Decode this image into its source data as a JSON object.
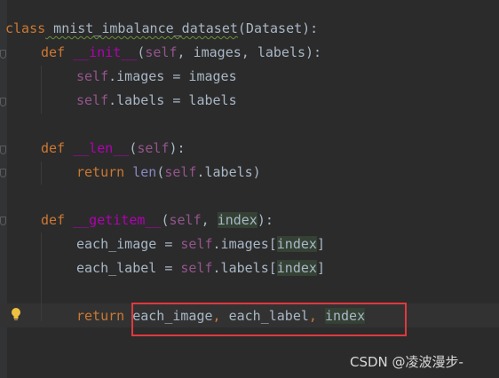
{
  "code": {
    "line1": {
      "kw": "class",
      "name": " mnist_imbalance_dataset",
      "rest": "(Dataset):"
    },
    "line2": {
      "kw": "def",
      "name": "__init__",
      "open": "(",
      "self": "self",
      "rest": ", images, labels):"
    },
    "line3": {
      "self": "self",
      "rest": ".images = images"
    },
    "line4": {
      "self": "self",
      "rest": ".labels = labels"
    },
    "line6": {
      "kw": "def",
      "name": "__len__",
      "open": "(",
      "self": "self",
      "rest": "):"
    },
    "line7": {
      "kw": "return",
      "builtin": "len",
      "open": "(",
      "self": "self",
      "rest": ".labels)"
    },
    "line9": {
      "kw": "def",
      "name": "__getitem__",
      "open": "(",
      "self": "self",
      "comma": ", ",
      "param": "index",
      "rest": "):"
    },
    "line10": {
      "lhs": "each_image = ",
      "self": "self",
      "attr": ".images[",
      "param": "index",
      "close": "]"
    },
    "line11": {
      "lhs": "each_label = ",
      "self": "self",
      "attr": ".labels[",
      "param": "index",
      "close": "]"
    },
    "line13": {
      "kw": "return",
      "v1": " each_image",
      "c1": ", ",
      "v2": "each_label",
      "c2": ", ",
      "param": "index"
    }
  },
  "watermark": "CSDN @凌波漫步-",
  "colors": {
    "background": "#2b2b2b",
    "keyword": "#cc7832",
    "self": "#94558d",
    "function": "#ffc66d",
    "highlight_box": "#e0393e"
  },
  "icons": [
    "fold-marker-icon",
    "lightbulb-icon"
  ]
}
